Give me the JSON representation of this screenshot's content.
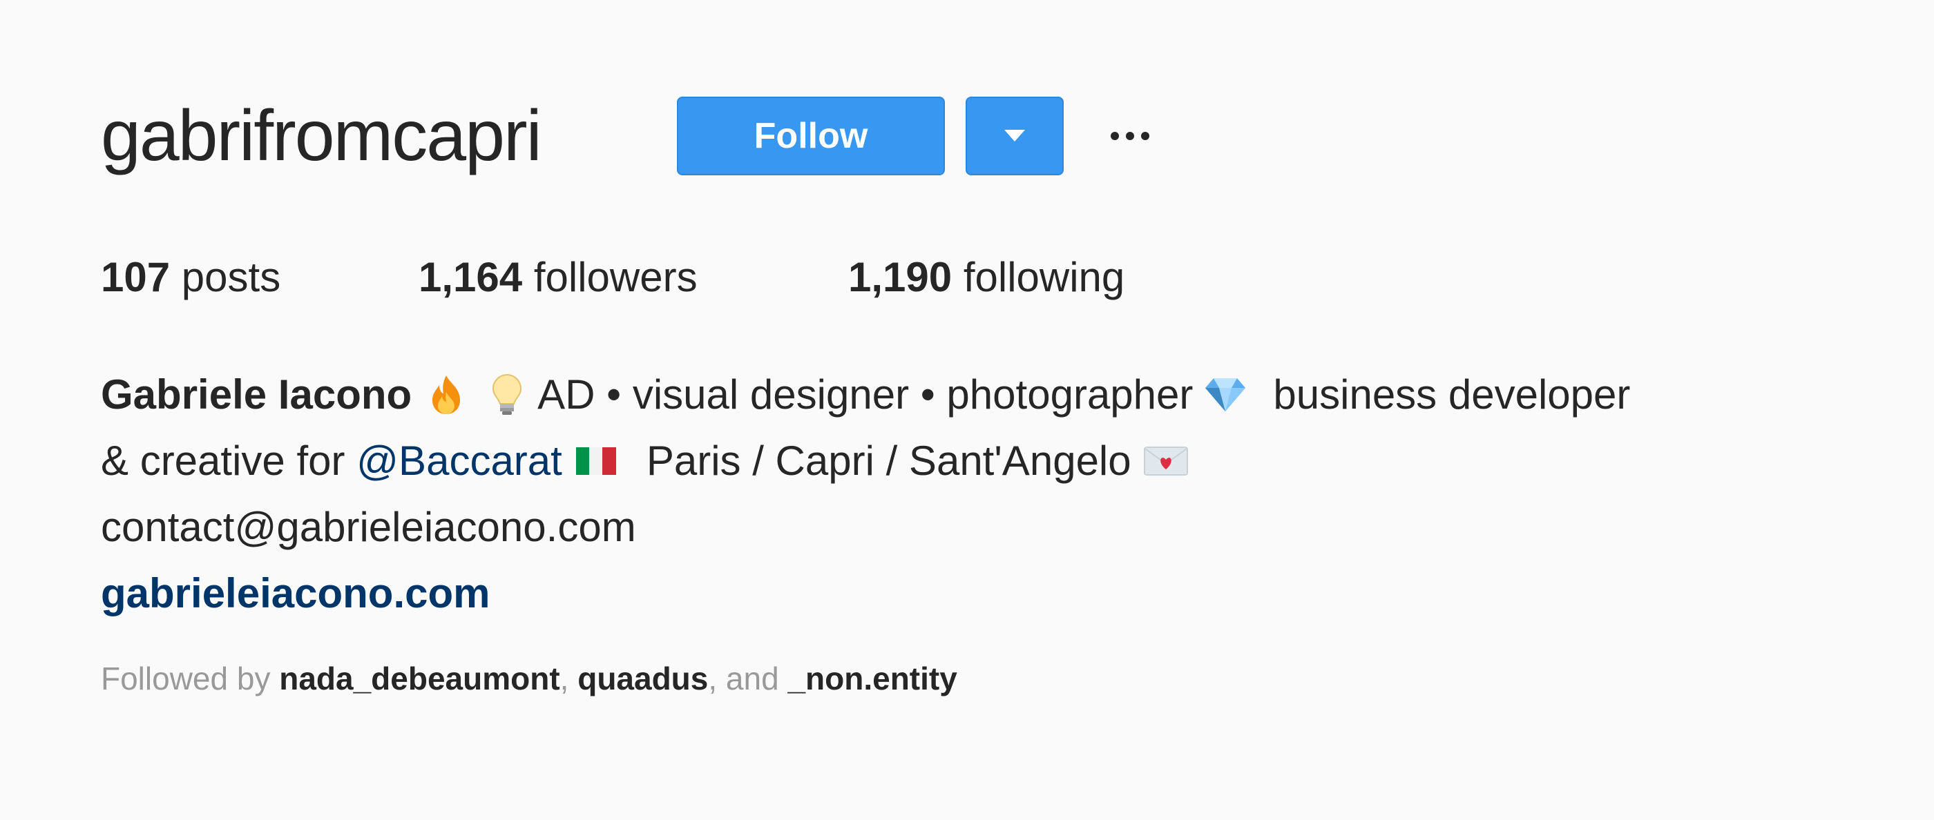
{
  "profile": {
    "username": "gabrifromcapri",
    "follow_label": "Follow"
  },
  "stats": {
    "posts_count": "107",
    "posts_label": " posts",
    "followers_count": "1,164",
    "followers_label": " followers",
    "following_count": "1,190",
    "following_label": " following"
  },
  "bio": {
    "full_name": "Gabriele Iacono",
    "line1_text": "AD • visual designer • photographer",
    "line1_tail": "business developer",
    "line2_prefix": "& creative for ",
    "mention": "@Baccarat",
    "line2_places": "Paris / Capri / Sant'Angelo",
    "email": "contact@gabrieleiacono.com",
    "website": "gabrieleiacono.com"
  },
  "followed_by": {
    "prefix": "Followed by ",
    "users": [
      "nada_debeaumont",
      "quaadus",
      "_non.entity"
    ],
    "sep1": ", ",
    "sep2": ", and "
  },
  "icons": {
    "emoji_1": "fire-emoji",
    "emoji_2": "lightbulb-emoji",
    "emoji_3": "gem-emoji",
    "emoji_4": "italy-flag-emoji",
    "emoji_5": "love-letter-emoji"
  },
  "colors": {
    "accent": "#3897f0",
    "link": "#003569",
    "text": "#262626",
    "muted": "#999999",
    "background": "#fafafa"
  }
}
